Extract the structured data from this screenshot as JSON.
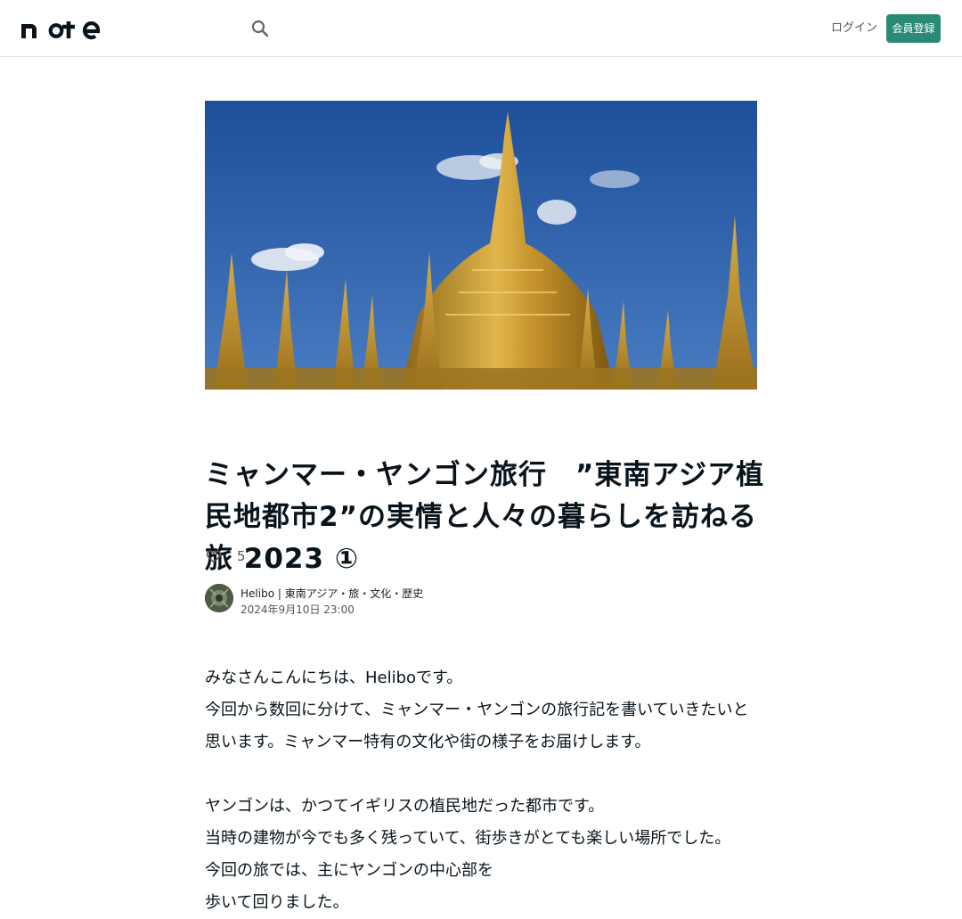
{
  "header": {
    "logo_text": "note",
    "login_label": "ログイン",
    "signup_label": "会員登録",
    "accent_color": "#2a8a76"
  },
  "hero": {
    "alt": "ミャンマー ヤンゴン シュエダゴン・パゴダ"
  },
  "article": {
    "title": "ミャンマー・ヤンゴン旅行　”東南アジア植民地都市2”の実情と人々の暮らしを訪ねる旅 2023 ①",
    "likes": "5",
    "author": "Helibo | 東南アジア・旅・文化・歴史",
    "date": "2024年9月10日 23:00",
    "paragraphs": [
      "みなさんこんにちは、Heliboです。",
      "今回から数回に分けて、ミャンマー・ヤンゴンの旅行記を書いていきたいと思います。ミャンマー特有の文化や街の様子をお届けします。",
      "",
      "ヤンゴンは、かつてイギリスの植民地だった都市です。",
      "当時の建物が今でも多く残っていて、街歩きがとても楽しい場所でした。",
      "今回の旅では、主にヤンゴンの中心部を",
      "歩いて回りました。"
    ]
  }
}
